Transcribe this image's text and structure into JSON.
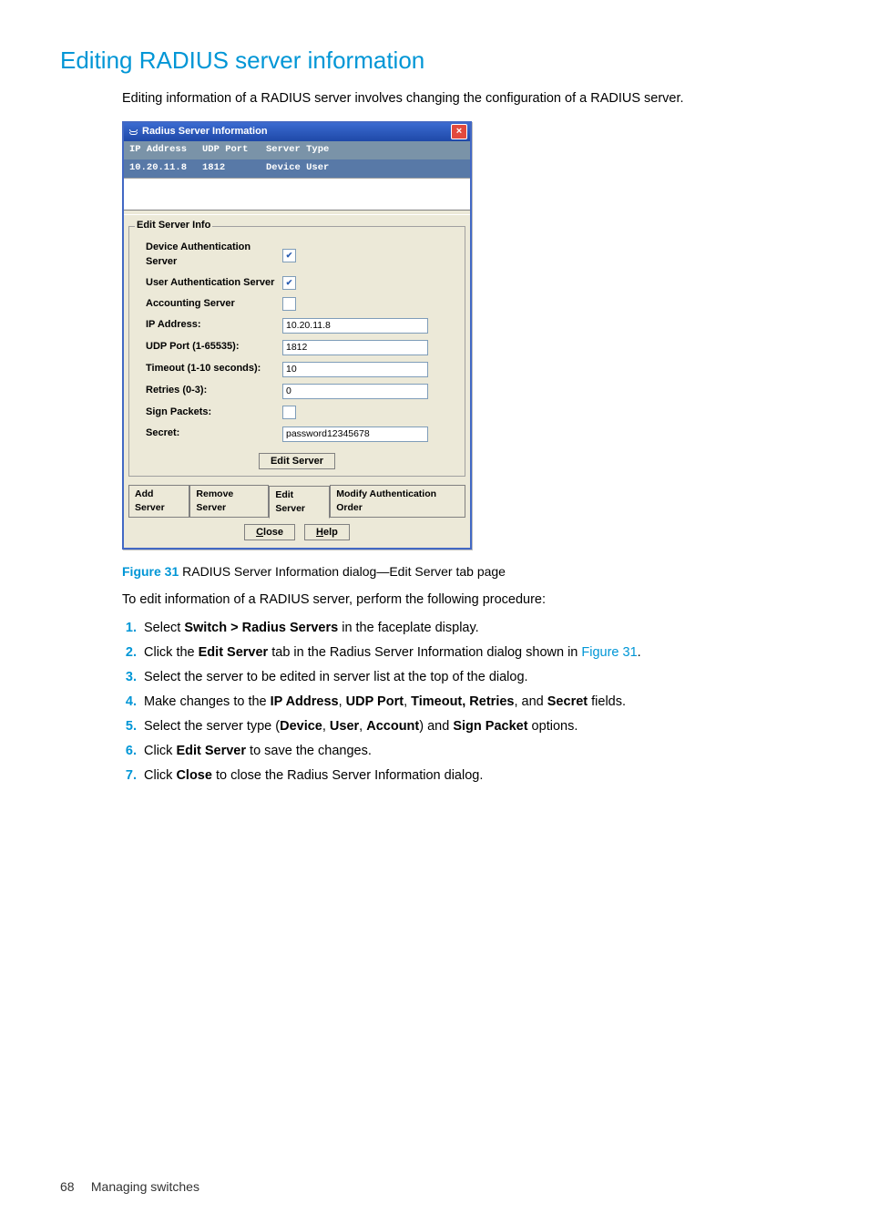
{
  "heading": "Editing RADIUS server information",
  "intro": "Editing information of a RADIUS server involves changing the configuration of a RADIUS server.",
  "dialog": {
    "title": "Radius Server Information",
    "close_glyph": "×",
    "columns": {
      "ip": "IP Address",
      "port": "UDP Port",
      "type": "Server Type"
    },
    "row": {
      "ip": "10.20.11.8",
      "port": "1812",
      "type": "Device  User"
    },
    "fieldset_legend": "Edit Server Info",
    "labels": {
      "dev_auth": "Device Authentication Server",
      "user_auth": "User Authentication Server",
      "acct": "Accounting Server",
      "ip": "IP Address:",
      "udp": "UDP Port (1-65535):",
      "timeout": "Timeout (1-10 seconds):",
      "retries": "Retries (0-3):",
      "sign": "Sign Packets:",
      "secret": "Secret:"
    },
    "values": {
      "dev_auth_checked": "✔",
      "user_auth_checked": "✔",
      "acct_checked": "",
      "ip": "10.20.11.8",
      "udp": "1812",
      "timeout": "10",
      "retries": "0",
      "sign_checked": "",
      "secret": "password12345678"
    },
    "edit_server_btn": "Edit Server",
    "tabs": {
      "add": "Add Server",
      "remove": "Remove Server",
      "edit": "Edit Server",
      "modify": "Modify Authentication Order"
    },
    "btn_close": "Close",
    "btn_close_ul": "C",
    "btn_help": "Help",
    "btn_help_ul": "H"
  },
  "figure": {
    "num": "Figure 31",
    "caption": "  RADIUS Server Information dialog—Edit Server tab page"
  },
  "proc_intro": "To edit information of a RADIUS server, perform the following procedure:",
  "steps": {
    "s1a": "Select ",
    "s1b": "Switch > Radius Servers",
    "s1c": " in the faceplate display.",
    "s2a": "Click the ",
    "s2b": "Edit Server",
    "s2c": " tab in the Radius Server Information dialog shown in ",
    "s2d": "Figure 31",
    "s2e": ".",
    "s3": "Select the server to be edited in server list at the top of the dialog.",
    "s4a": "Make changes to the ",
    "s4b": "IP Address",
    "s4c": ", ",
    "s4d": "UDP Port",
    "s4e": ", ",
    "s4f": "Timeout, Retries",
    "s4g": ", and ",
    "s4h": "Secret",
    "s4i": " fields.",
    "s5a": "Select the server type (",
    "s5b": "Device",
    "s5c": ", ",
    "s5d": "User",
    "s5e": ", ",
    "s5f": "Account",
    "s5g": ") and ",
    "s5h": "Sign Packet",
    "s5i": " options.",
    "s6a": "Click ",
    "s6b": "Edit Server",
    "s6c": " to save the changes.",
    "s7a": "Click ",
    "s7b": "Close",
    "s7c": " to close the Radius Server Information dialog."
  },
  "footer": {
    "page": "68",
    "chapter": "Managing switches"
  }
}
